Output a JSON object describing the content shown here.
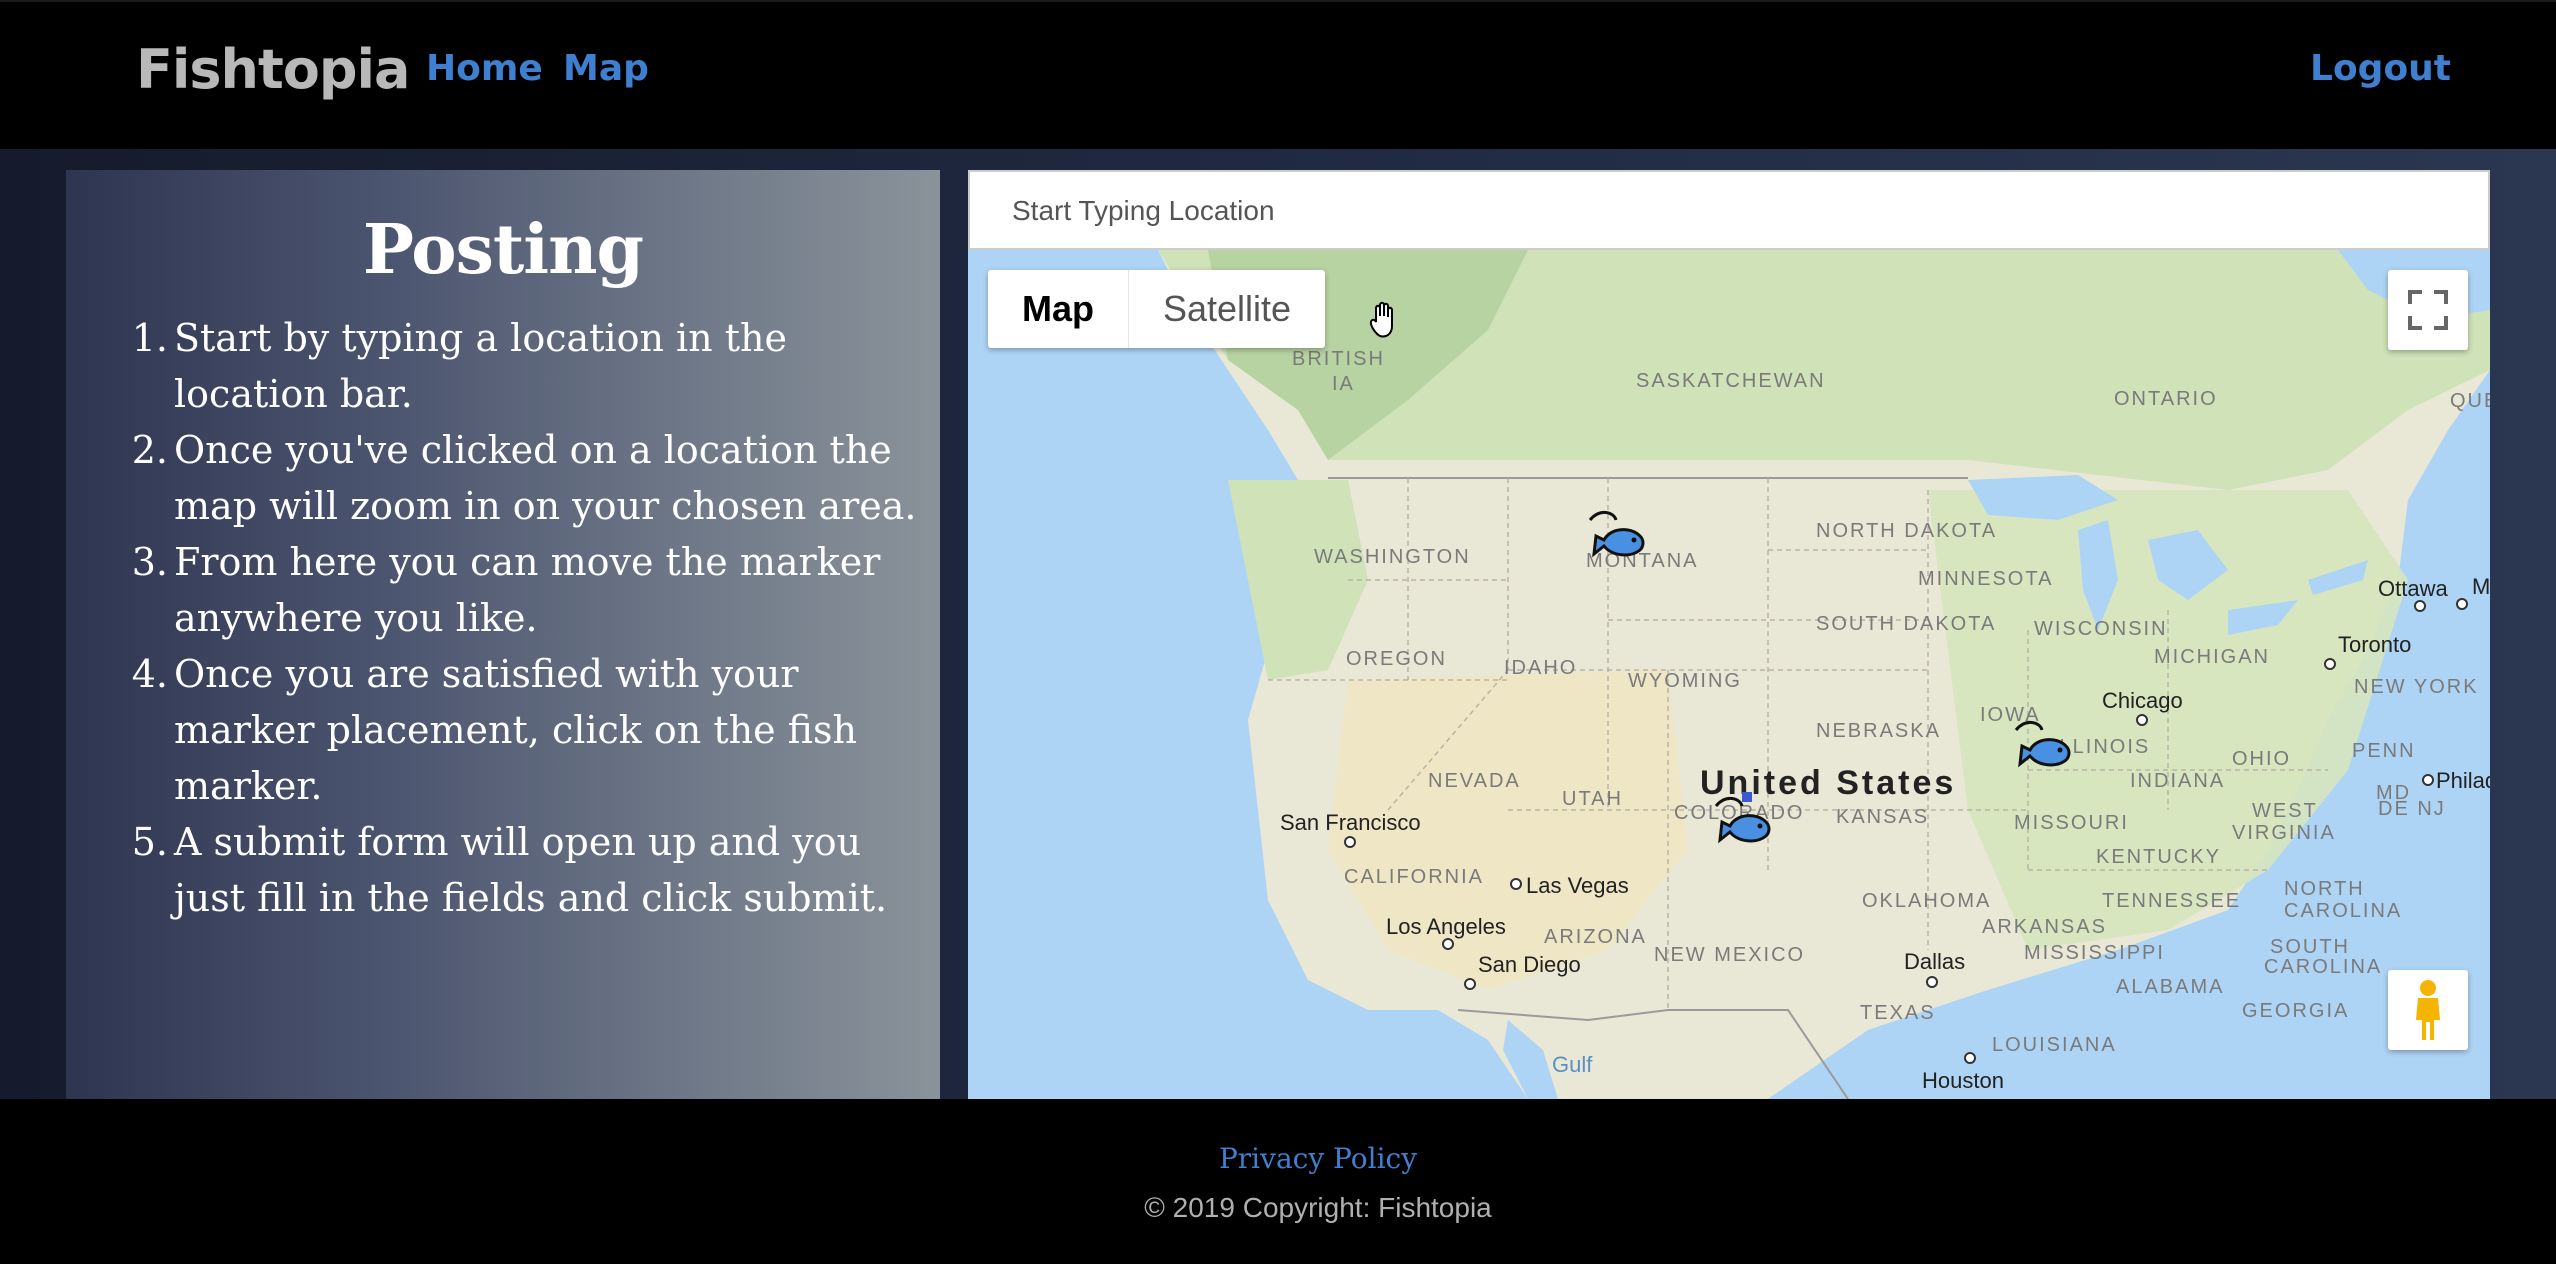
{
  "navbar": {
    "brand": "Fishtopia",
    "links": {
      "home": "Home",
      "map": "Map",
      "logout": "Logout"
    },
    "colors": {
      "background": "#000000",
      "link": "#3f7fd0",
      "brand": "#b8b8b8"
    }
  },
  "instructions": {
    "title": "Posting",
    "steps": [
      {
        "num": "1.",
        "text": "Start by typing a location in the location bar."
      },
      {
        "num": "2.",
        "text": "Once you've clicked on a location the map will zoom in on your chosen area."
      },
      {
        "num": "3.",
        "text": "From here you can move the marker anywhere you like."
      },
      {
        "num": "4.",
        "text": "Once you are satisfied with your marker placement, click on the fish marker."
      },
      {
        "num": "5.",
        "text": "A submit form will open up and you just fill in the fields and click submit."
      }
    ]
  },
  "map": {
    "search": {
      "placeholder": "Start Typing Location"
    },
    "map_type": {
      "map": "Map",
      "satellite": "Satellite"
    },
    "active_map_type": "Map",
    "icons": {
      "fullscreen": "fullscreen-icon",
      "street_view": "pegman-icon",
      "marker": "fish-marker-icon",
      "cursor": "grab-hand-icon"
    },
    "labels": {
      "country": "United States",
      "provinces": [
        "BRITISH",
        "SASKATCHEWAN",
        "ONTARIO",
        "QUEB",
        "IA"
      ],
      "states": [
        "WASHINGTON",
        "MONTANA",
        "NORTH DAKOTA",
        "MINNESOTA",
        "SOUTH DAKOTA",
        "WISCONSIN",
        "OREGON",
        "IDAHO",
        "WYOMING",
        "MICHIGAN",
        "NEW YORK",
        "IOWA",
        "NEBRASKA",
        "ILLINOIS",
        "OHIO",
        "PENN",
        "NEVADA",
        "UTAH",
        "COLORADO",
        "KANSAS",
        "INDIANA",
        "MISSOURI",
        "WEST",
        "VIRGINIA",
        "MD",
        "DE NJ",
        "KENTUCKY",
        "CALIFORNIA",
        "ARIZONA",
        "NEW MEXICO",
        "OKLAHOMA",
        "TENNESSEE",
        "NORTH",
        "CAROLINA",
        "ARKANSAS",
        "MISSISSIPPI",
        "SOUTH",
        "CAROLINA",
        "TEXAS",
        "ALABAMA",
        "GEORGIA",
        "LOUISIANA"
      ],
      "cities": [
        "San Francisco",
        "Las Vegas",
        "Los Angeles",
        "San Diego",
        "Dallas",
        "Houston",
        "Chicago",
        "Toronto",
        "Ottawa",
        "Philad",
        "M"
      ],
      "water": "Gulf"
    },
    "marker_count": 3
  },
  "footer": {
    "privacy": "Privacy Policy",
    "copyright": "© 2019 Copyright: Fishtopia"
  }
}
